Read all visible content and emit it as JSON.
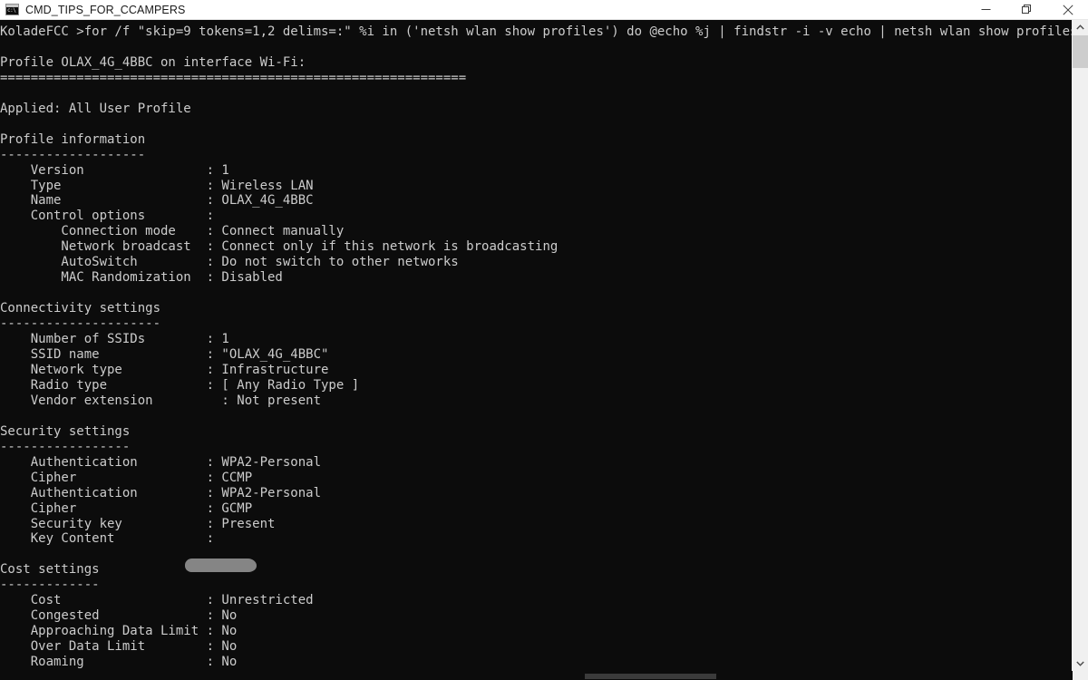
{
  "window": {
    "title": "CMD_TIPS_FOR_CCAMPERS",
    "app_icon": "cmd-console-icon",
    "controls": {
      "minimize": "minimize-icon",
      "restore": "restore-icon",
      "close": "close-icon"
    },
    "background_color": "#0c0c0c",
    "text_color": "#cccccc",
    "titlebar_color": "#ffffff"
  },
  "scrollbars": {
    "vertical": {
      "up_arrow": "chevron-up-icon",
      "down_arrow": "chevron-down-icon",
      "thumb_position": "top"
    },
    "horizontal": {
      "thumb_position": "center"
    }
  },
  "terminal": {
    "prompt": "KoladeFCC >",
    "command": "for /f \"skip=9 tokens=1,2 delims=:\" %i in ('netsh wlan show profiles') do @echo %j | findstr -i -v echo | netsh wlan show profiles %j key=clear",
    "redacted_field": "Key Content",
    "output": "\nProfile OLAX_4G_4BBC on interface Wi-Fi:\n=============================================================\n\nApplied: All User Profile\n\nProfile information\n-------------------\n    Version                : 1\n    Type                   : Wireless LAN\n    Name                   : OLAX_4G_4BBC\n    Control options        :\n        Connection mode    : Connect manually\n        Network broadcast  : Connect only if this network is broadcasting\n        AutoSwitch         : Do not switch to other networks\n        MAC Randomization  : Disabled\n\nConnectivity settings\n---------------------\n    Number of SSIDs        : 1\n    SSID name              : \"OLAX_4G_4BBC\"\n    Network type           : Infrastructure\n    Radio type             : [ Any Radio Type ]\n    Vendor extension         : Not present\n\nSecurity settings\n-----------------\n    Authentication         : WPA2-Personal\n    Cipher                 : CCMP\n    Authentication         : WPA2-Personal\n    Cipher                 : GCMP\n    Security key           : Present\n    Key Content            :\n\nCost settings\n-------------\n    Cost                   : Unrestricted\n    Congested              : No\n    Approaching Data Limit : No\n    Over Data Limit        : No\n    Roaming                : No"
  }
}
